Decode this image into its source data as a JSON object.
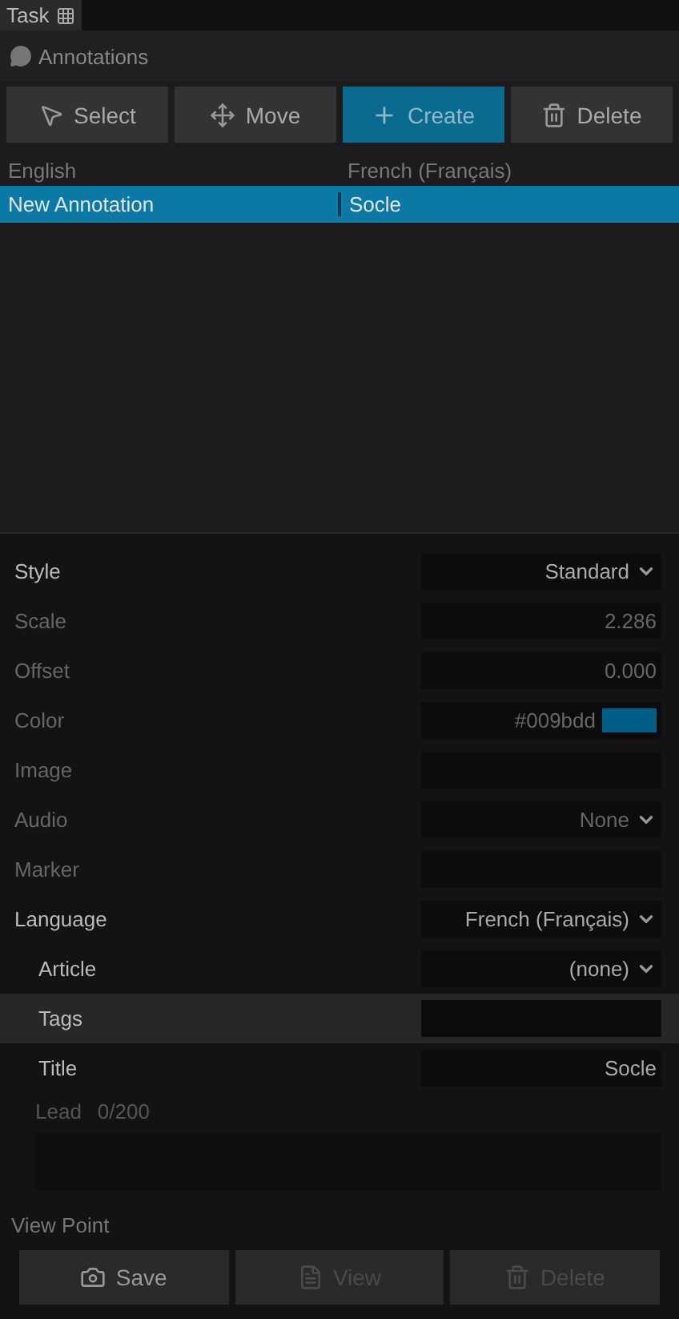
{
  "task_tab": {
    "label": "Task"
  },
  "panel": {
    "title": "Annotations"
  },
  "tools": [
    {
      "label": "Select",
      "selected": false
    },
    {
      "label": "Move",
      "selected": false
    },
    {
      "label": "Create",
      "selected": true
    },
    {
      "label": "Delete",
      "selected": false
    }
  ],
  "table": {
    "columns": [
      "English",
      "French (Français)"
    ],
    "rows": [
      {
        "cells": [
          "New Annotation",
          "Socle"
        ],
        "selected": true
      }
    ]
  },
  "properties": [
    {
      "label": "Style",
      "kind": "select",
      "value": "Standard",
      "disabled": false,
      "selected": false
    },
    {
      "label": "Scale",
      "kind": "text",
      "value": "2.286",
      "disabled": true,
      "selected": false
    },
    {
      "label": "Offset",
      "kind": "text",
      "value": "0.000",
      "disabled": true,
      "selected": false
    },
    {
      "label": "Color",
      "kind": "color",
      "value": "#009bdd",
      "color": "#005f87",
      "disabled": true,
      "selected": false
    },
    {
      "label": "Image",
      "kind": "text",
      "disabled": true,
      "selected": false
    },
    {
      "label": "Audio",
      "kind": "select",
      "value": "None",
      "disabled": true,
      "selected": false
    },
    {
      "label": "Marker",
      "kind": "text",
      "disabled": true,
      "selected": false
    },
    {
      "label": "Language",
      "kind": "select",
      "value": "French (Français)",
      "disabled": false,
      "selected": false,
      "children": [
        {
          "label": "Article",
          "kind": "select",
          "value": "(none)",
          "disabled": false,
          "selected": false
        },
        {
          "label": "Tags",
          "kind": "text",
          "disabled": false,
          "selected": true
        },
        {
          "label": "Title",
          "kind": "text",
          "value": "Socle",
          "disabled": false,
          "selected": false
        }
      ]
    }
  ],
  "lead": {
    "label": "Lead",
    "counter": "0/200"
  },
  "view_point": {
    "title": "View Point",
    "buttons": [
      {
        "label": "Save",
        "disabled": false
      },
      {
        "label": "View",
        "disabled": true
      },
      {
        "label": "Delete",
        "disabled": true
      }
    ]
  }
}
